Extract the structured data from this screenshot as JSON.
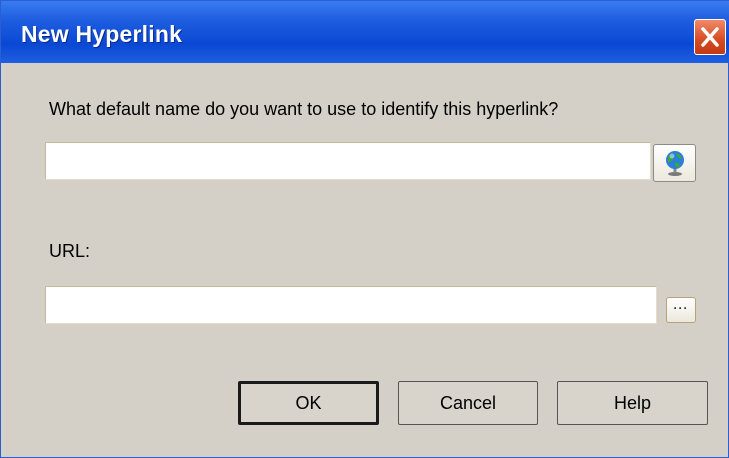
{
  "window": {
    "title": "New Hyperlink",
    "close_icon": "close-icon"
  },
  "form": {
    "name_prompt": "What default name do you want to use to identify this hyperlink?",
    "name_value": "",
    "name_icon": "globe-icon",
    "url_label": "URL:",
    "url_value": "",
    "browse_icon": "ellipsis-icon",
    "browse_label": "···"
  },
  "buttons": {
    "ok": "OK",
    "cancel": "Cancel",
    "help": "Help"
  },
  "colors": {
    "titlebar": "#0a48d4",
    "close": "#d84a20",
    "dialog_bg": "#d4d0c8"
  }
}
